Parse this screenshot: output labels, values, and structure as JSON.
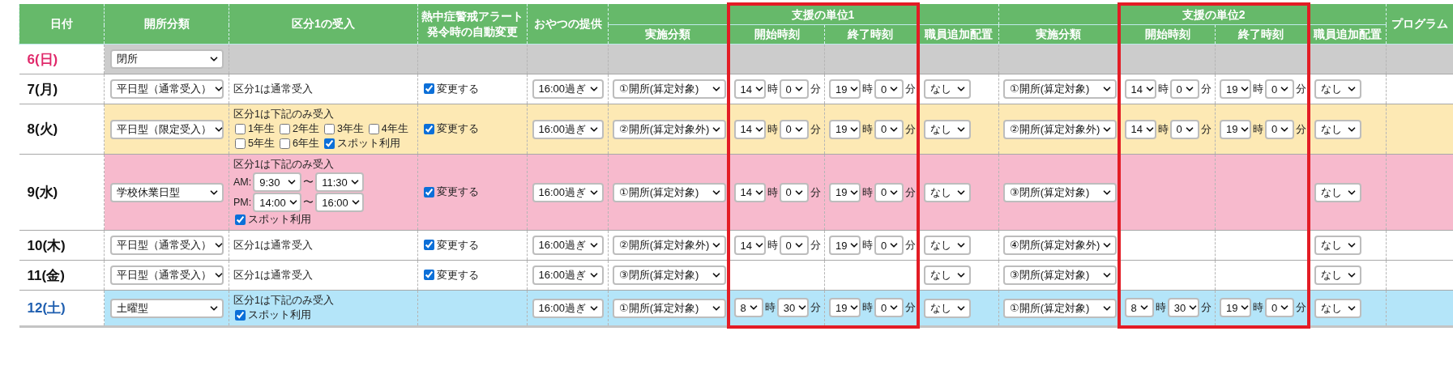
{
  "header": {
    "date": "日付",
    "open_type": "開所分類",
    "kubun1": "区分1の受入",
    "heat_alert": [
      "熱中症警戒アラート",
      "発令時の自動変更"
    ],
    "snack": "おやつの提供",
    "units": [
      {
        "impl": "実施分類",
        "title": "支援の単位1",
        "start": "開始時刻",
        "end": "終了時刻",
        "staff": "職員追加配置",
        "highlighted": true
      },
      {
        "impl": "実施分類",
        "title": "支援の単位2",
        "start": "開始時刻",
        "end": "終了時刻",
        "staff": "職員追加配置",
        "highlighted": true
      }
    ],
    "program": "プログラム"
  },
  "rows": [
    {
      "date": "6(日)",
      "color": "#e0286a",
      "kind": "closed",
      "open_type": "閉所"
    },
    {
      "date": "7(月)",
      "color": "#111111",
      "kind": "normal",
      "open_type": "平日型（通常受入）",
      "kubun1": {
        "kind": "text",
        "text": "区分1は通常受入"
      },
      "heat": {
        "label": "変更する",
        "checked": true
      },
      "snack": "16:00過ぎ",
      "units": [
        {
          "impl": "①開所(算定対象)",
          "time": {
            "start": {
              "hour": "14",
              "hour_suffix": "時",
              "minute": "0",
              "minute_suffix": "分"
            },
            "end": {
              "hour": "19",
              "hour_suffix": "時",
              "minute": "0",
              "minute_suffix": "分"
            }
          },
          "staff": "なし"
        },
        {
          "impl": "①開所(算定対象)",
          "time": {
            "start": {
              "hour": "14",
              "hour_suffix": "時",
              "minute": "0",
              "minute_suffix": "分"
            },
            "end": {
              "hour": "19",
              "hour_suffix": "時",
              "minute": "0",
              "minute_suffix": "分"
            }
          },
          "staff": "なし"
        }
      ]
    },
    {
      "date": "8(火)",
      "color": "#111111",
      "kind": "limited",
      "open_type": "平日型（限定受入）",
      "kubun1": {
        "kind": "options",
        "text": "区分1は下記のみ受入",
        "options": [
          {
            "label": "1年生",
            "checked": false
          },
          {
            "label": "2年生",
            "checked": false
          },
          {
            "label": "3年生",
            "checked": false
          },
          {
            "label": "4年生",
            "checked": false
          },
          {
            "label": "5年生",
            "checked": false
          },
          {
            "label": "6年生",
            "checked": false
          },
          {
            "label": "スポット利用",
            "checked": true
          }
        ]
      },
      "heat": {
        "label": "変更する",
        "checked": true
      },
      "snack": "16:00過ぎ",
      "units": [
        {
          "impl": "②開所(算定対象外)",
          "time": {
            "start": {
              "hour": "14",
              "hour_suffix": "時",
              "minute": "0",
              "minute_suffix": "分"
            },
            "end": {
              "hour": "19",
              "hour_suffix": "時",
              "minute": "0",
              "minute_suffix": "分"
            }
          },
          "staff": "なし"
        },
        {
          "impl": "②開所(算定対象外)",
          "time": {
            "start": {
              "hour": "14",
              "hour_suffix": "時",
              "minute": "0",
              "minute_suffix": "分"
            },
            "end": {
              "hour": "19",
              "hour_suffix": "時",
              "minute": "0",
              "minute_suffix": "分"
            }
          },
          "staff": "なし"
        }
      ]
    },
    {
      "date": "9(水)",
      "color": "#111111",
      "kind": "holiday",
      "open_type": "学校休業日型",
      "kubun1": {
        "kind": "times",
        "text": "区分1は下記のみ受入",
        "periods": [
          {
            "label": "AM:",
            "from": "9:30",
            "sep": "〜",
            "to": "11:30"
          },
          {
            "label": "PM:",
            "from": "14:00",
            "sep": "〜",
            "to": "16:00"
          }
        ],
        "options": [
          {
            "label": "スポット利用",
            "checked": true
          }
        ]
      },
      "heat": {
        "label": "変更する",
        "checked": true
      },
      "snack": "16:00過ぎ",
      "units": [
        {
          "impl": "①開所(算定対象)",
          "time": {
            "start": {
              "hour": "14",
              "hour_suffix": "時",
              "minute": "0",
              "minute_suffix": "分"
            },
            "end": {
              "hour": "19",
              "hour_suffix": "時",
              "minute": "0",
              "minute_suffix": "分"
            }
          },
          "staff": "なし"
        },
        {
          "impl": "③閉所(算定対象)",
          "staff": "なし"
        }
      ]
    },
    {
      "date": "10(木)",
      "color": "#111111",
      "kind": "normal",
      "open_type": "平日型（通常受入）",
      "kubun1": {
        "kind": "text",
        "text": "区分1は通常受入"
      },
      "heat": {
        "label": "変更する",
        "checked": true
      },
      "snack": "16:00過ぎ",
      "units": [
        {
          "impl": "②開所(算定対象外)",
          "time": {
            "start": {
              "hour": "14",
              "hour_suffix": "時",
              "minute": "0",
              "minute_suffix": "分"
            },
            "end": {
              "hour": "19",
              "hour_suffix": "時",
              "minute": "0",
              "minute_suffix": "分"
            }
          },
          "staff": "なし"
        },
        {
          "impl": "④閉所(算定対象外)",
          "staff": "なし"
        }
      ]
    },
    {
      "date": "11(金)",
      "color": "#111111",
      "kind": "normal",
      "open_type": "平日型（通常受入）",
      "kubun1": {
        "kind": "text",
        "text": "区分1は通常受入"
      },
      "heat": {
        "label": "変更する",
        "checked": true
      },
      "snack": "16:00過ぎ",
      "units": [
        {
          "impl": "③閉所(算定対象)",
          "staff": "なし"
        },
        {
          "impl": "③閉所(算定対象)",
          "staff": "なし"
        }
      ]
    },
    {
      "date": "12(土)",
      "color": "#1f5fb0",
      "kind": "saturday",
      "open_type": "土曜型",
      "kubun1": {
        "kind": "options",
        "text": "区分1は下記のみ受入",
        "options": [
          {
            "label": "スポット利用",
            "checked": true
          }
        ]
      },
      "snack": "16:00過ぎ",
      "units": [
        {
          "impl": "①開所(算定対象)",
          "time": {
            "start": {
              "hour": "8",
              "hour_suffix": "時",
              "minute": "30",
              "minute_suffix": "分"
            },
            "end": {
              "hour": "19",
              "hour_suffix": "時",
              "minute": "0",
              "minute_suffix": "分"
            }
          },
          "staff": "なし"
        },
        {
          "impl": "①開所(算定対象)",
          "time": {
            "start": {
              "hour": "8",
              "hour_suffix": "時",
              "minute": "30",
              "minute_suffix": "分"
            },
            "end": {
              "hour": "19",
              "hour_suffix": "時",
              "minute": "0",
              "minute_suffix": "分"
            }
          },
          "staff": "なし"
        }
      ]
    }
  ]
}
